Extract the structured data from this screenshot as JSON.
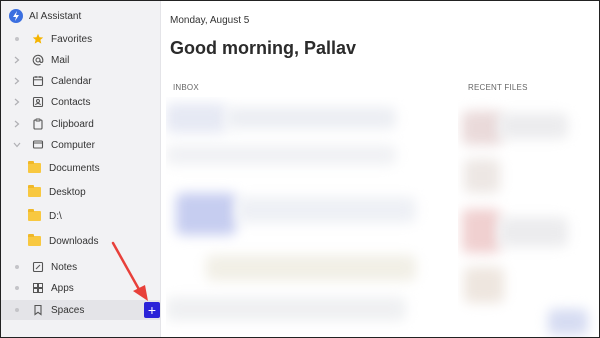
{
  "app": {
    "title": "AI Assistant",
    "logo_icon": "lightning-icon",
    "accent": "#3b6fe0"
  },
  "sidebar": {
    "items": [
      {
        "label": "Favorites",
        "icon": "star-icon",
        "lead": "dot"
      },
      {
        "label": "Mail",
        "icon": "at-icon",
        "lead": "chevron-right"
      },
      {
        "label": "Calendar",
        "icon": "calendar-icon",
        "lead": "chevron-right"
      },
      {
        "label": "Contacts",
        "icon": "contacts-icon",
        "lead": "chevron-right"
      },
      {
        "label": "Clipboard",
        "icon": "clipboard-icon",
        "lead": "chevron-right"
      },
      {
        "label": "Computer",
        "icon": "computer-icon",
        "lead": "chevron-down"
      },
      {
        "label": "Documents",
        "icon": "folder-icon",
        "sub": true
      },
      {
        "label": "Desktop",
        "icon": "folder-icon",
        "sub": true
      },
      {
        "label": "D:\\",
        "icon": "folder-icon",
        "sub": true
      },
      {
        "label": "Downloads",
        "icon": "folder-icon",
        "sub": true
      },
      {
        "label": "Notes",
        "icon": "notes-icon",
        "lead": "dot"
      },
      {
        "label": "Apps",
        "icon": "apps-icon",
        "lead": "dot"
      },
      {
        "label": "Spaces",
        "icon": "bookmark-icon",
        "lead": "dot",
        "active": true
      }
    ],
    "add_button_label": "+",
    "add_button_color": "#2a22d8"
  },
  "annotation": {
    "arrow_color": "#e8403a"
  },
  "main": {
    "date": "Monday, August 5",
    "greeting": "Good morning, Pallav",
    "columns": {
      "inbox": "INBOX",
      "recent_files": "RECENT FILES"
    }
  }
}
